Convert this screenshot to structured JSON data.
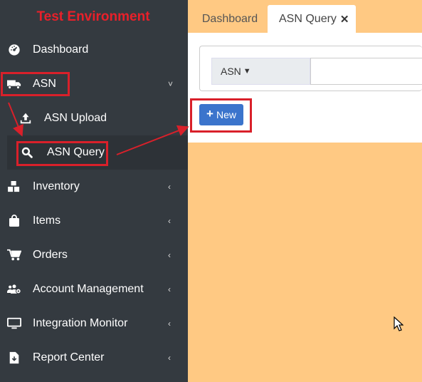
{
  "sidebar": {
    "env_title": "Test Environment",
    "items": [
      {
        "label": "Dashboard",
        "icon": "dashboard-icon"
      },
      {
        "label": "ASN",
        "icon": "truck-icon",
        "expanded": true
      },
      {
        "label": "ASN Upload",
        "icon": "upload-icon"
      },
      {
        "label": "ASN Query",
        "icon": "search-icon",
        "active": true
      },
      {
        "label": "Inventory",
        "icon": "boxes-icon"
      },
      {
        "label": "Items",
        "icon": "bag-icon"
      },
      {
        "label": "Orders",
        "icon": "cart-icon"
      },
      {
        "label": "Account Management",
        "icon": "users-cog-icon"
      },
      {
        "label": "Integration Monitor",
        "icon": "monitor-icon"
      },
      {
        "label": "Report Center",
        "icon": "file-download-icon"
      }
    ],
    "chev_expanded": "˅",
    "chev_collapsed": "‹"
  },
  "tabs": {
    "dashboard": "Dashboard",
    "asn_query": "ASN Query",
    "close": "✕"
  },
  "filter": {
    "field_label": "ASN",
    "caret": "▼",
    "input_value": ""
  },
  "toolbar": {
    "new_label": "New",
    "new_plus": "+"
  },
  "colors": {
    "sidebar_bg": "#343a40",
    "accent_blue": "#3b74cc",
    "annotation_red": "#d9202a",
    "page_bg": "#ffc983"
  }
}
